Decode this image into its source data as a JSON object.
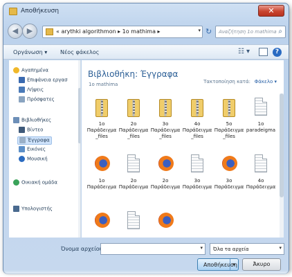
{
  "window": {
    "title": "Αποθήκευση",
    "close_glyph": "✕"
  },
  "nav": {
    "back_glyph": "◀",
    "forward_glyph": "▶",
    "address_crumbs": "« arythki algorithmon ▸ 1o mathima ▸",
    "refresh_glyph": "↻",
    "search_placeholder": "Αναζήτηση 1o mathima"
  },
  "toolbar": {
    "organize_label": "Οργάνωση ▾",
    "new_folder_label": "Νέος φάκελος",
    "views_glyph": "☷ ▾",
    "help_glyph": "?"
  },
  "sidebar": {
    "items": [
      {
        "label": "Αγαπημένα",
        "icon": "star-icon",
        "color": "#f0b82a",
        "kind": "header"
      },
      {
        "label": "Επιφάνεια εργασ",
        "icon": "desktop-icon",
        "color": "#3a6ab0",
        "kind": "sub"
      },
      {
        "label": "Λήψεις",
        "icon": "downloads-icon",
        "color": "#4a7ab8",
        "kind": "sub"
      },
      {
        "label": "Πρόσφατες",
        "icon": "recent-icon",
        "color": "#8aa4c0",
        "kind": "sub"
      },
      {
        "label": "Βιβλιοθήκες",
        "icon": "libraries-icon",
        "color": "#6d8fb8",
        "kind": "header"
      },
      {
        "label": "Βίντεο",
        "icon": "video-icon",
        "color": "#3f5a7a",
        "kind": "sub"
      },
      {
        "label": "Έγγραφα",
        "icon": "documents-icon",
        "color": "#9ab0c8",
        "kind": "sub-selected"
      },
      {
        "label": "Εικόνες",
        "icon": "pictures-icon",
        "color": "#5c8fc8",
        "kind": "sub"
      },
      {
        "label": "Μουσική",
        "icon": "music-icon",
        "color": "#2b6bc0",
        "kind": "sub"
      },
      {
        "label": "Οικιακή ομάδα",
        "icon": "homegroup-icon",
        "color": "#3aa35a",
        "kind": "header"
      },
      {
        "label": "Υπολογιστής",
        "icon": "computer-icon",
        "color": "#4a6a8f",
        "kind": "header"
      }
    ]
  },
  "content": {
    "library_title": "Βιβλιοθήκη: Έγγραφα",
    "library_subtitle": "1o mathima",
    "arrange_label": "Τακτοποίηση κατά:",
    "arrange_value": "Φάκελο ▾",
    "files": [
      {
        "label": "1o Παράδειγμα_files",
        "type": "zip-folder"
      },
      {
        "label": "2o Παράδειγμα_files",
        "type": "zip-folder"
      },
      {
        "label": "3o Παράδειγμα_files",
        "type": "zip-folder"
      },
      {
        "label": "4o Παράδειγμα_files",
        "type": "zip-folder"
      },
      {
        "label": "5o Παράδειγμα_files",
        "type": "zip-folder"
      },
      {
        "label": "1o paradeigma",
        "type": "document"
      },
      {
        "label": "1o Παράδειγμα",
        "type": "firefox-html"
      },
      {
        "label": "2o Παράδειγμα",
        "type": "document"
      },
      {
        "label": "2o Παράδειγμα",
        "type": "firefox-html"
      },
      {
        "label": "3o Παράδειγμα",
        "type": "document"
      },
      {
        "label": "3o Παράδειγμα",
        "type": "firefox-html"
      },
      {
        "label": "4o Παράδειγμα",
        "type": "document"
      },
      {
        "label": "",
        "type": "firefox-html"
      },
      {
        "label": "",
        "type": "document"
      },
      {
        "label": "",
        "type": "firefox-html"
      }
    ]
  },
  "footer": {
    "filename_label": "Όνομα αρχείου:",
    "filename_value": "",
    "filetype_value": "Όλα τα αρχεία",
    "save_label": "Αποθήκευση",
    "cancel_label": "Άκυρο",
    "dropdown_glyph": "▾"
  }
}
